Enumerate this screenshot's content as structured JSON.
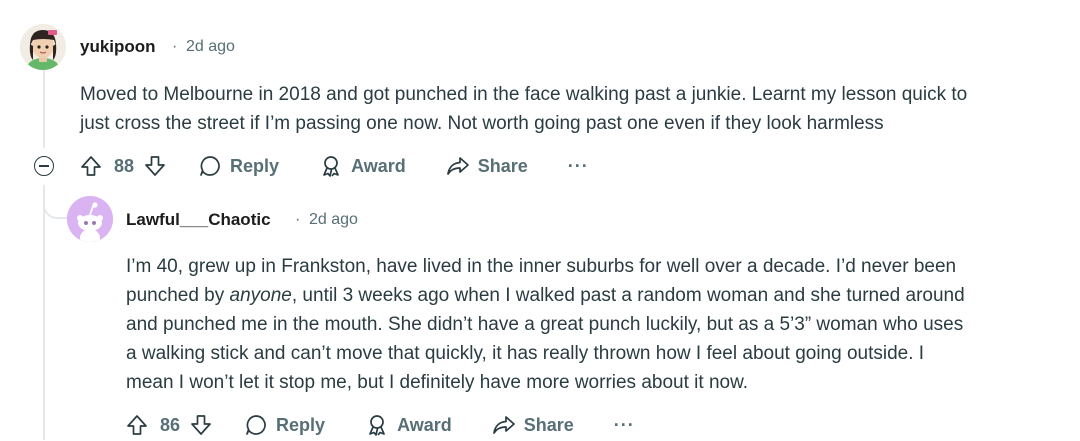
{
  "comments": [
    {
      "author": "yukipoon",
      "separator": "·",
      "time": "2d ago",
      "body_lines": [
        "Moved to Melbourne in 2018 and got punched in the face walking past a junkie. Learnt my lesson quick to",
        "just cross the street if I’m passing one now. Not worth going past one even if they look harmless"
      ],
      "score": "88",
      "reply_label": "Reply",
      "award_label": "Award",
      "share_label": "Share",
      "more_label": "···"
    },
    {
      "author": "Lawful___Chaotic",
      "separator": "·",
      "time": "2d ago",
      "body_line1": "I’m 40, grew up in Frankston, have lived in the inner suburbs for well over a decade. I’d never been",
      "body_line2_a": "punched by ",
      "body_line2_em": "anyone",
      "body_line2_b": ", until 3 weeks ago when I walked past a random woman and she turned around",
      "body_rest": [
        "and punched me in the mouth. She didn’t have a great punch luckily, but as a 5’3” woman who uses",
        "a walking stick and can’t move that quickly, it has really thrown how I feel about going outside. I",
        "mean I won’t let it stop me, but I definitely have more worries about it now."
      ],
      "score": "86",
      "reply_label": "Reply",
      "award_label": "Award",
      "share_label": "Share",
      "more_label": "···"
    }
  ],
  "colors": {
    "text": "#2a3c42",
    "meta": "#576f76",
    "thread_line": "#e5e8eb",
    "snoo_bg": "#d9b3f2"
  }
}
